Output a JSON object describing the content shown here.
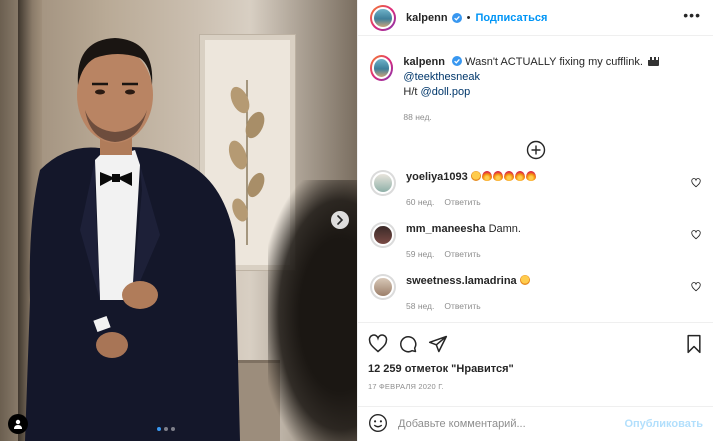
{
  "post": {
    "username": "kalpenn",
    "follow_label": "Подписаться",
    "separator": "•",
    "more_label": "•••",
    "carousel": {
      "total": 3,
      "active": 0
    }
  },
  "caption": {
    "username": "kalpenn",
    "text": "Wasn't ACTUALLY fixing my cufflink.",
    "mention1": "@teekthesneak",
    "hat_tip": "H/t",
    "mention2": "@doll.pop",
    "time": "88 нед."
  },
  "comments": [
    {
      "username": "yoeliya1093",
      "emojis": [
        "star",
        "fire",
        "fire",
        "fire",
        "fire",
        "fire"
      ],
      "text": "",
      "time": "60 нед.",
      "reply": "Ответить"
    },
    {
      "username": "mm_maneesha",
      "emojis": [],
      "text": "Damn.",
      "time": "59 нед.",
      "reply": "Ответить"
    },
    {
      "username": "sweetness.lamadrina",
      "emojis": [
        "star"
      ],
      "text": "",
      "time": "58 нед.",
      "reply": "Ответить"
    }
  ],
  "likes": {
    "count": "12 259",
    "label": "отметок \"Нравится\""
  },
  "date": "17 ФЕВРАЛЯ 2020 Г.",
  "composer": {
    "placeholder": "Добавьте комментарий...",
    "publish_label": "Опубликовать"
  },
  "colors": {
    "accent": "#0095f6",
    "verified": "#3897f0",
    "muted": "#8e8e8e",
    "publish_disabled": "#b2dffc"
  }
}
